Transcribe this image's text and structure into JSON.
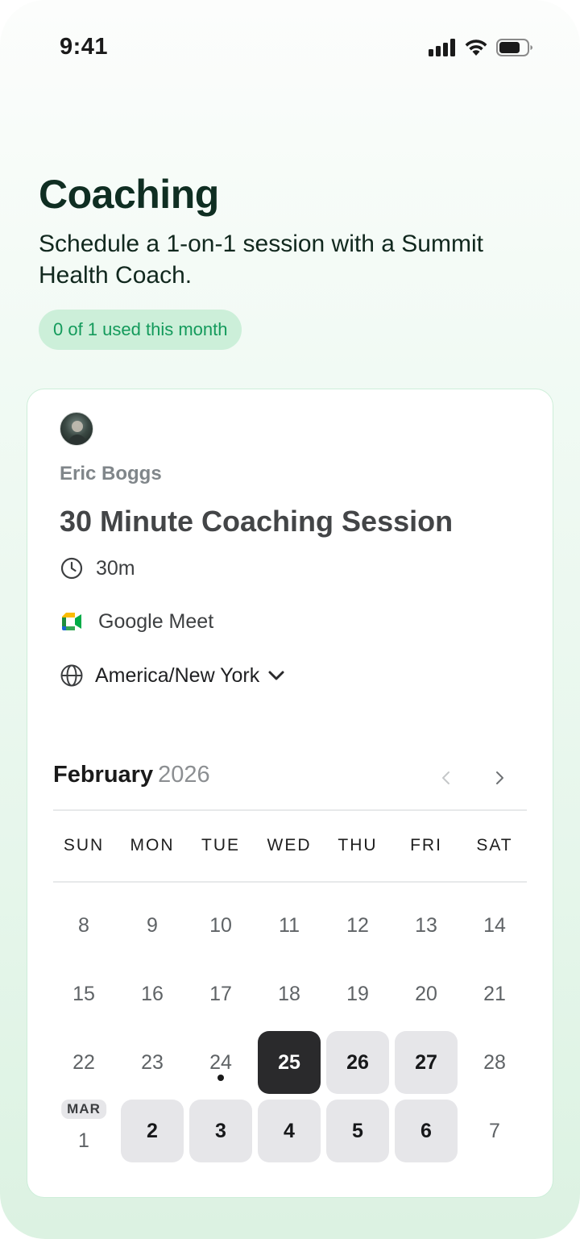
{
  "status_bar": {
    "time": "9:41",
    "signal_icon": "signal-bars-icon",
    "wifi_icon": "wifi-icon",
    "battery_icon": "battery-icon"
  },
  "header": {
    "title": "Coaching",
    "subtitle": "Schedule a 1-on-1 session with a Summit Health Coach.",
    "usage_badge": "0 of 1 used this month"
  },
  "event": {
    "coach_name": "Eric Boggs",
    "title": "30 Minute Coaching Session",
    "duration": "30m",
    "location": "Google Meet",
    "timezone": "America/New York"
  },
  "calendar": {
    "month": "February",
    "year": "2026",
    "weekdays": [
      "SUN",
      "MON",
      "TUE",
      "WED",
      "THU",
      "FRI",
      "SAT"
    ],
    "weeks": [
      [
        {
          "label": "8"
        },
        {
          "label": "9"
        },
        {
          "label": "10"
        },
        {
          "label": "11"
        },
        {
          "label": "12"
        },
        {
          "label": "13"
        },
        {
          "label": "14"
        }
      ],
      [
        {
          "label": "15"
        },
        {
          "label": "16"
        },
        {
          "label": "17"
        },
        {
          "label": "18"
        },
        {
          "label": "19"
        },
        {
          "label": "20"
        },
        {
          "label": "21"
        }
      ],
      [
        {
          "label": "22"
        },
        {
          "label": "23"
        },
        {
          "label": "24",
          "today": true
        },
        {
          "label": "25",
          "selected": true
        },
        {
          "label": "26",
          "available": true
        },
        {
          "label": "27",
          "available": true
        },
        {
          "label": "28"
        }
      ],
      [
        {
          "label": "1",
          "tag": "MAR"
        },
        {
          "label": "2",
          "available": true
        },
        {
          "label": "3",
          "available": true
        },
        {
          "label": "4",
          "available": true
        },
        {
          "label": "5",
          "available": true
        },
        {
          "label": "6",
          "available": true
        },
        {
          "label": "7"
        }
      ]
    ]
  },
  "colors": {
    "accent": "#139a5b",
    "badge_bg": "#ccefd9",
    "title": "#0f2e22",
    "selected_day": "#2a2a2c",
    "available_day": "#e6e6e9"
  }
}
